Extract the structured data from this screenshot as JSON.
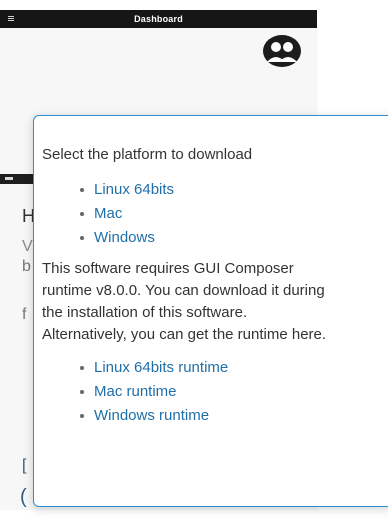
{
  "preview": {
    "topbar_title": "Dashboard"
  },
  "popover": {
    "heading": "Select the platform to download",
    "platforms": [
      {
        "label": "Linux 64bits"
      },
      {
        "label": "Mac"
      },
      {
        "label": "Windows"
      }
    ],
    "note_lines": [
      "This software requires GUI Composer",
      "runtime v8.0.0. You can download it during",
      "the installation of this software.",
      "Alternatively, you can get the runtime here."
    ],
    "runtimes": [
      {
        "label": "Linux 64bits runtime"
      },
      {
        "label": "Mac runtime"
      },
      {
        "label": "Windows runtime"
      }
    ]
  },
  "colors": {
    "popover_border": "#2b8fd6",
    "link": "#1f6fa8",
    "topbar": "#161616"
  }
}
